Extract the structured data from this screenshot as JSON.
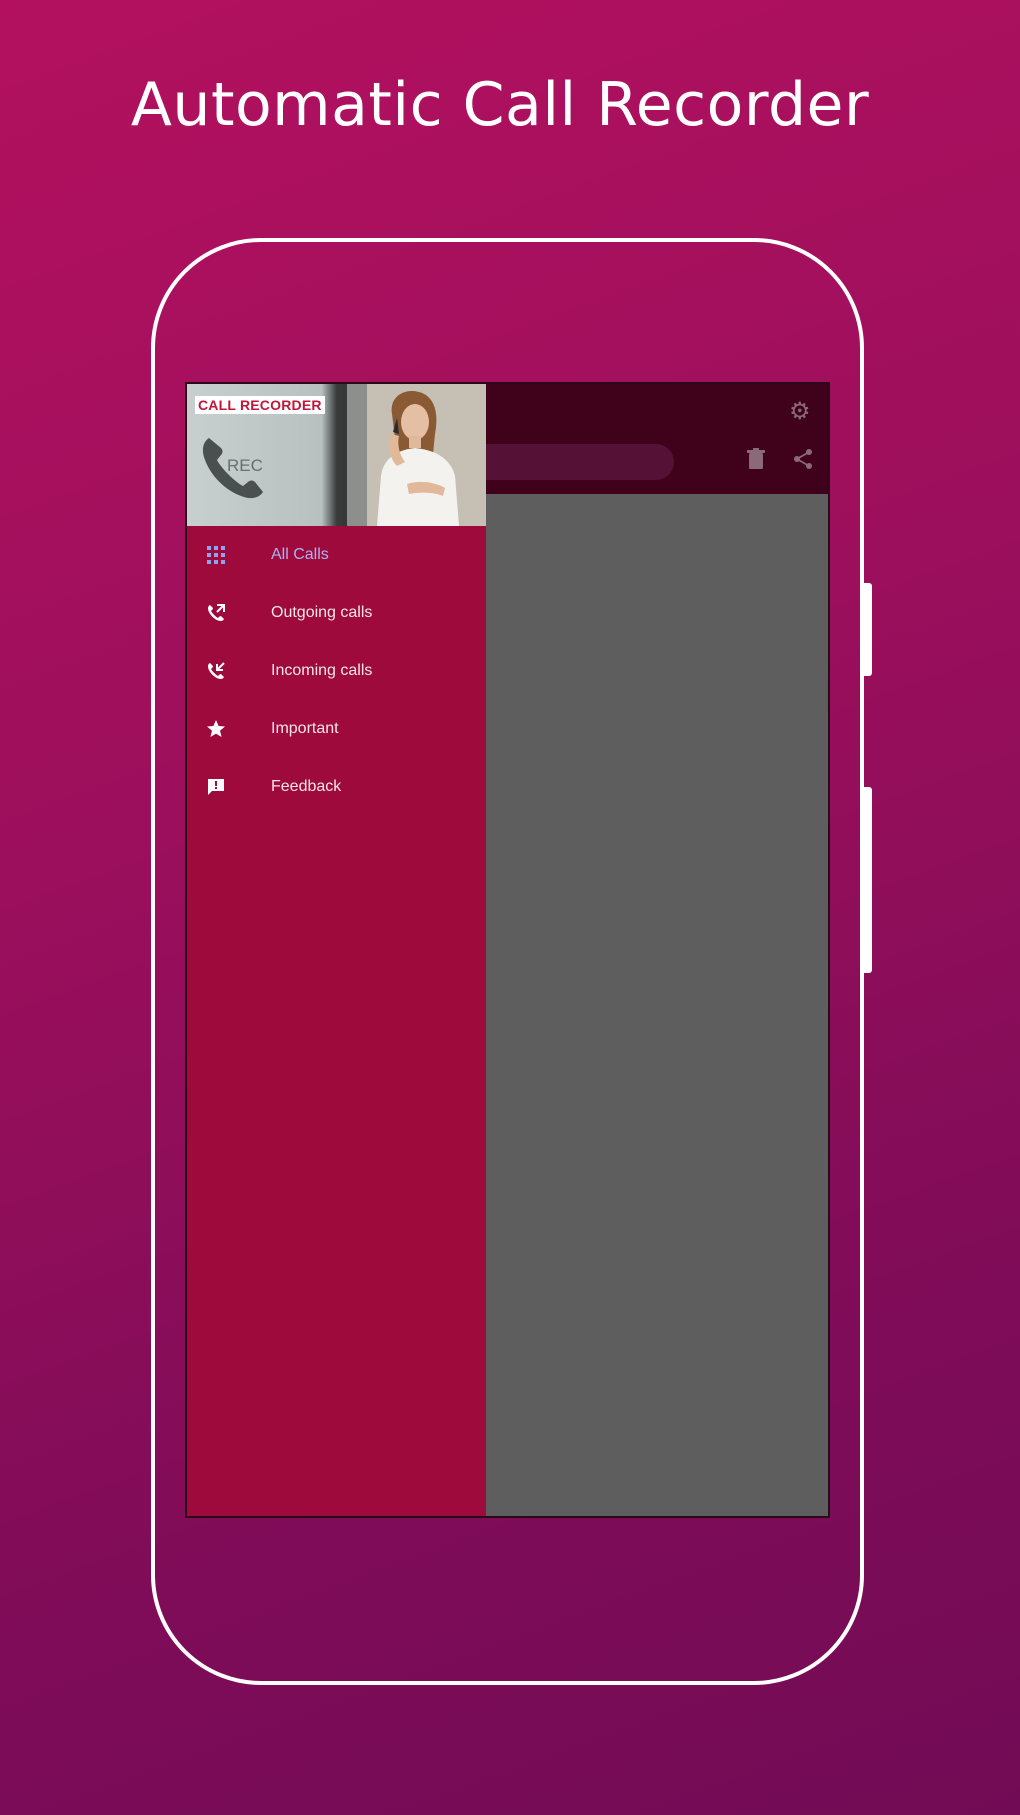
{
  "headline": "Automatic Call Recorder",
  "drawer": {
    "header": {
      "brand_label": "CALL RECORDER",
      "rec_label": "REC"
    },
    "items": [
      {
        "label": "All Calls",
        "icon": "grid-icon",
        "active": true
      },
      {
        "label": "Outgoing calls",
        "icon": "outgoing-call-icon",
        "active": false
      },
      {
        "label": "Incoming calls",
        "icon": "incoming-call-icon",
        "active": false
      },
      {
        "label": "Important",
        "icon": "star-icon",
        "active": false
      },
      {
        "label": "Feedback",
        "icon": "feedback-icon",
        "active": false
      }
    ]
  },
  "appbar": {
    "icons": [
      "settings-icon",
      "delete-icon",
      "share-icon"
    ]
  },
  "colors": {
    "background_top": "#b3115f",
    "background_bottom": "#720b55",
    "drawer": "#9d0a3b",
    "appbar": "#40021a",
    "scrim": "#5e5e5e",
    "active_item": "#a7b6f3"
  }
}
